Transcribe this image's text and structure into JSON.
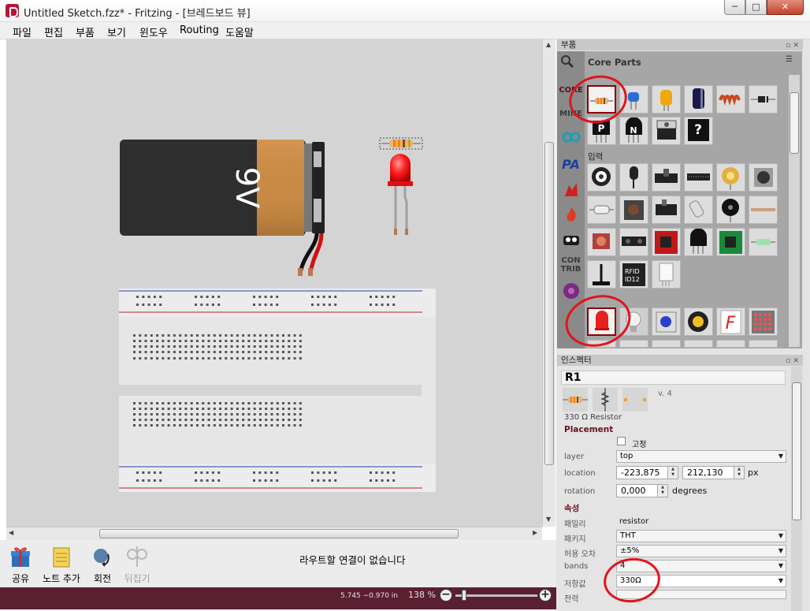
{
  "window": {
    "title": "Untitled Sketch.fzz* - Fritzing - [브레드보드 뷰]",
    "min_glyph": "─",
    "max_glyph": "□",
    "close_glyph": "✕"
  },
  "menu": [
    "파일",
    "편집",
    "부품",
    "보기",
    "윈도우",
    "Routing",
    "도움말"
  ],
  "canvas": {
    "battery_label": "9V"
  },
  "toolbar": {
    "share": "공유",
    "add_note": "노트 추가",
    "rotate": "회전",
    "flip": "뒤집기",
    "routing_status": "라우트할 연결이 없습니다"
  },
  "statusbar": {
    "coordinates": "5.745 −0.970 in",
    "zoom": "138 %",
    "zoom_out": "−",
    "zoom_in": "+"
  },
  "parts_panel": {
    "header": "부품",
    "title": "Core Parts",
    "bins": [
      "CORE",
      "MINE",
      "CON TRIB"
    ],
    "groups": {
      "input": "입력"
    },
    "selected_part": "resistor"
  },
  "inspector": {
    "header": "인스펙터",
    "title": "R1",
    "version": "v. 4",
    "part_caption": "330 Ω Resistor",
    "placement_header": "Placement",
    "lock_label": "고정",
    "layer_label": "layer",
    "layer_value": "top",
    "location_label": "location",
    "location_x": "-223,875",
    "location_y": "212,130",
    "location_unit": "px",
    "rotation_label": "rotation",
    "rotation_value": "0,000",
    "rotation_unit": "degrees",
    "properties_header": "속성",
    "family_label": "패밀리",
    "family_value": "resistor",
    "package_label": "패키지",
    "package_value": "THT",
    "tolerance_label": "허용 오차",
    "tolerance_value": "±5%",
    "bands_label": "bands",
    "bands_value": "4",
    "resistance_label": "저항값",
    "resistance_value": "330Ω",
    "next_label": "전력"
  }
}
